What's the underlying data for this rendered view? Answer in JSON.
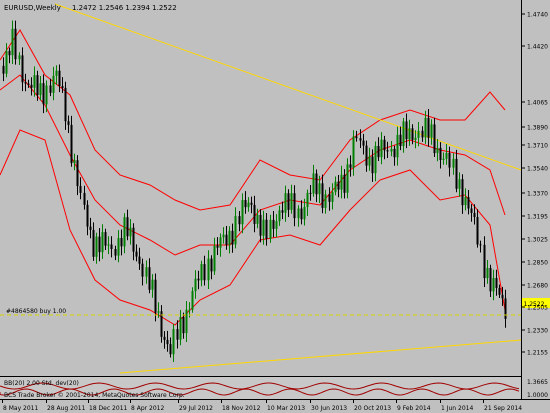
{
  "chart": {
    "symbol_header": "EURUSD,Weekly",
    "ohlc_header": "1.2472 1.2546 1.2394 1.2522",
    "order_line_label": "#4864580 buy 1.00",
    "current_price": "1.2522",
    "watermark": "BCS Trade Broker © 2001-2014, MetaQuotes Software Corp.",
    "indicator_label": "BB(20) 2.00 Std. dev(20)",
    "colors": {
      "background": "#c0c0c0",
      "bull_candle": "#008000",
      "bear_candle": "#000000",
      "bands": "#ff0000",
      "trendline": "#ffd700",
      "order_line": "#d4d400",
      "price_badge": "#ffff00"
    }
  },
  "axis": {
    "y_ticks": [
      "1.4740",
      "1.4420",
      "1.4065",
      "1.3890",
      "1.3710",
      "1.3540",
      "1.3370",
      "1.3195",
      "1.3025",
      "1.2850",
      "1.2680",
      "1.2505",
      "1.2330",
      "1.2155"
    ],
    "x_ticks": [
      "8 May 2011",
      "28 Aug 2011",
      "18 Dec 2011",
      "8 Apr 2012",
      "29 Jul 2012",
      "18 Nov 2012",
      "10 Mar 2013",
      "30 Jun 2013",
      "20 Oct 2013",
      "9 Feb 2014",
      "1 Jun 2014",
      "21 Sep 2014"
    ],
    "sub_ticks": [
      "1.3665",
      "1.0000"
    ]
  },
  "chart_data": {
    "type": "candlestick",
    "symbol": "EURUSD",
    "timeframe": "Weekly",
    "last_bar": {
      "open": 1.2472,
      "high": 1.2546,
      "low": 1.2394,
      "close": 1.2522
    },
    "ylim": [
      1.1965,
      1.492
    ],
    "x": [
      "8 May 2011",
      "28 Aug 2011",
      "18 Dec 2011",
      "8 Apr 2012",
      "29 Jul 2012",
      "18 Nov 2012",
      "10 Mar 2013",
      "30 Jun 2013",
      "20 Oct 2013",
      "9 Feb 2014",
      "1 Jun 2014",
      "21 Sep 2014"
    ],
    "series": [
      {
        "name": "EURUSD",
        "values": [
          1.442,
          1.41,
          1.336,
          1.305,
          1.22,
          1.286,
          1.301,
          1.312,
          1.362,
          1.361,
          1.34,
          1.255
        ]
      }
    ],
    "annotations": [
      "#4864580 buy 1.00"
    ]
  }
}
